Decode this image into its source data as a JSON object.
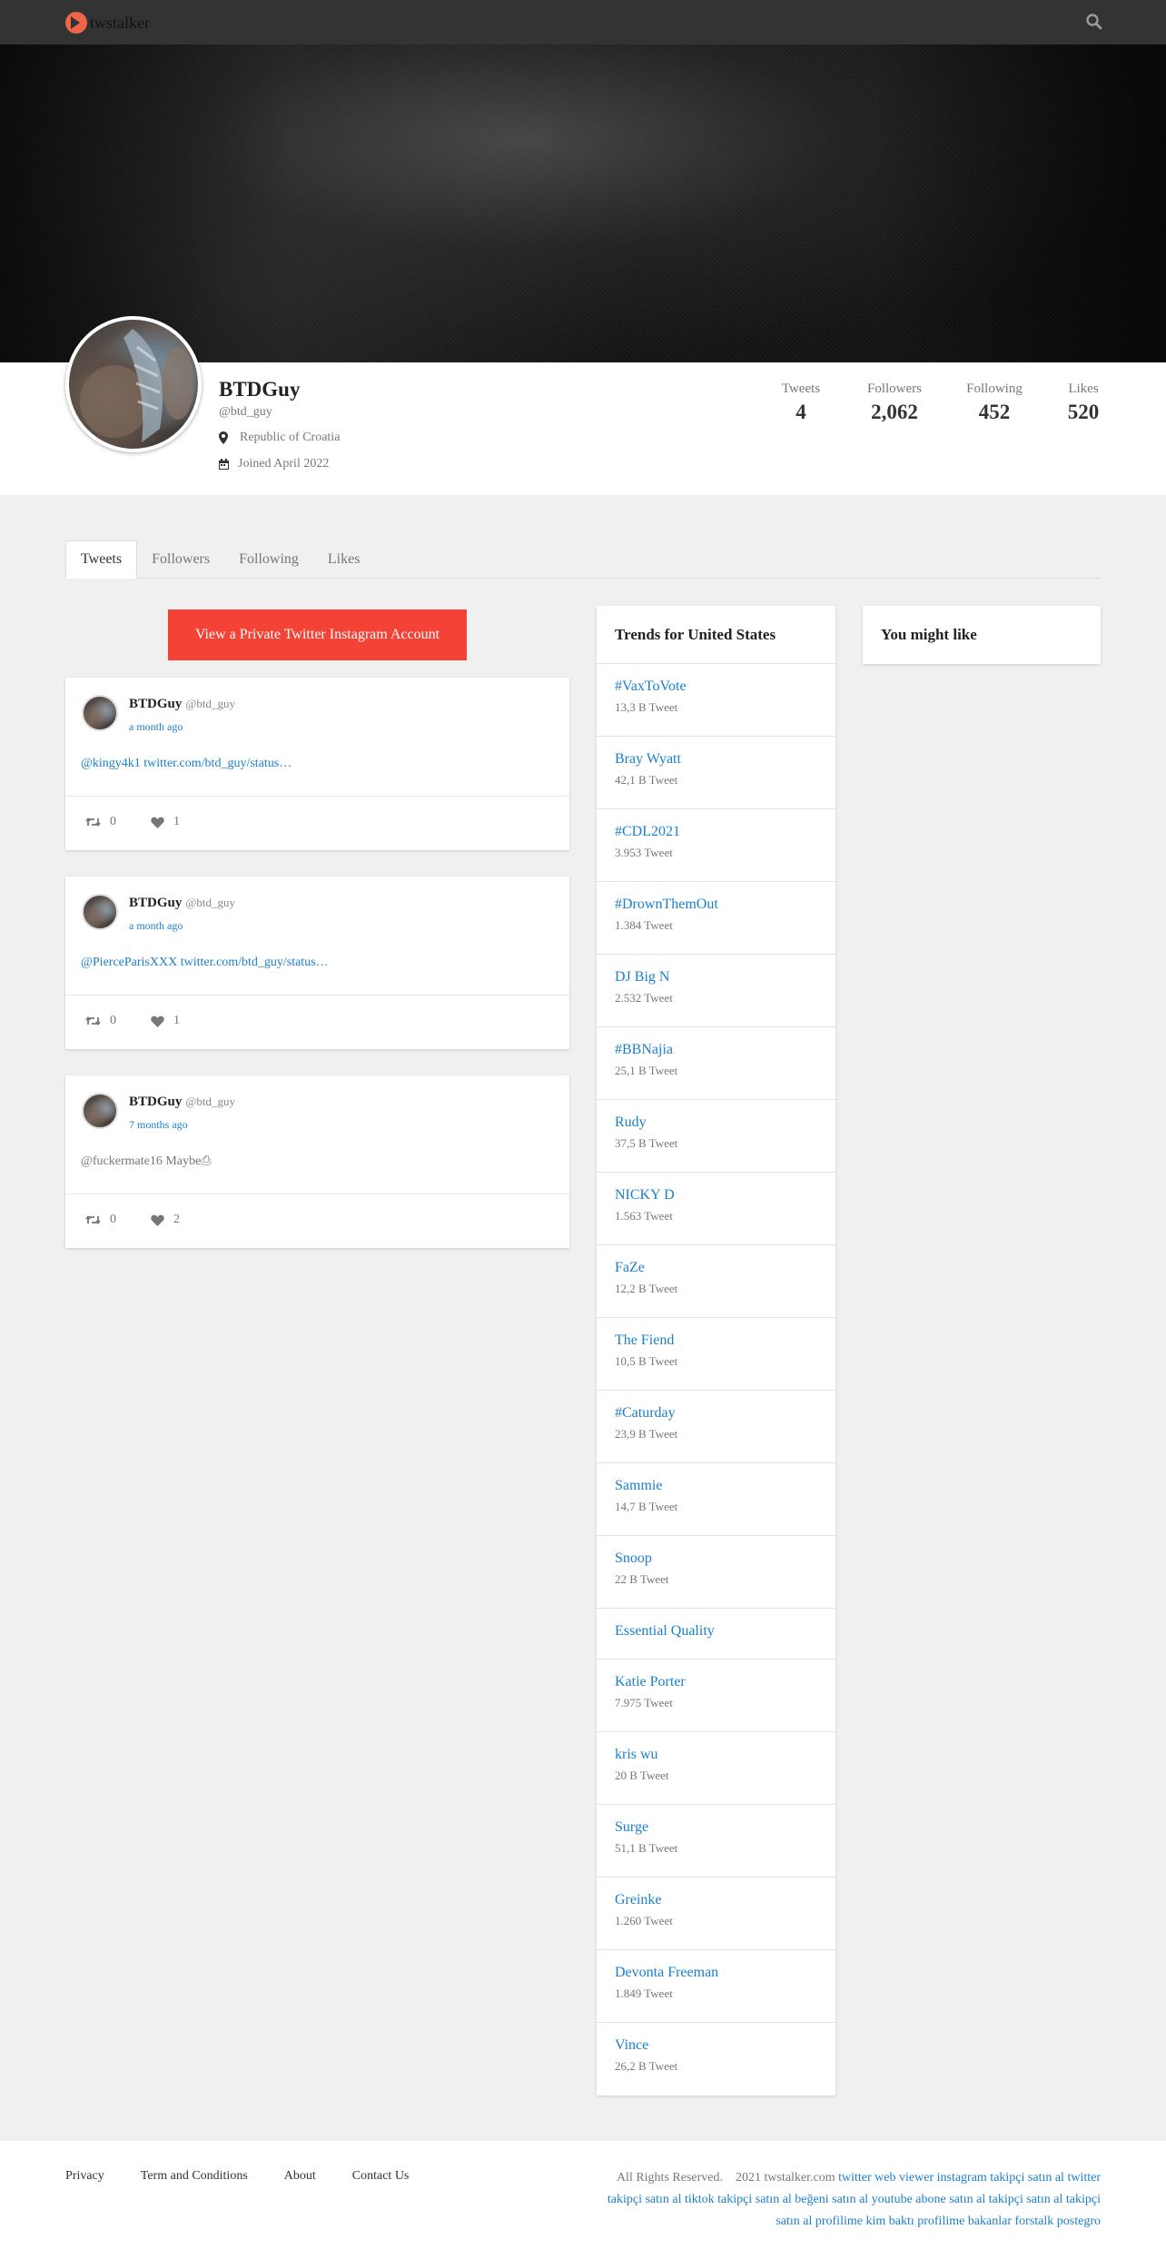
{
  "nav": {
    "brand": "twstalker",
    "brand_color": "#f0654a",
    "search_icon": "search-icon"
  },
  "profile": {
    "name": "BTDGuy",
    "handle": "@btd_guy",
    "location": "Republic of Croatia",
    "joined": "Joined April 2022",
    "stats": [
      {
        "label": "Tweets",
        "value": "4"
      },
      {
        "label": "Followers",
        "value": "2,062"
      },
      {
        "label": "Following",
        "value": "452"
      },
      {
        "label": "Likes",
        "value": "520"
      }
    ]
  },
  "tabs": [
    "Tweets",
    "Followers",
    "Following",
    "Likes"
  ],
  "cta": {
    "label": "View a Private Twitter Instagram Account",
    "color": "#f44336"
  },
  "tweets": [
    {
      "name": "BTDGuy",
      "handle": "@btd_guy",
      "time": "a month ago",
      "text": "@kingy4k1 twitter.com/btd_guy/status…",
      "retweets": "0",
      "likes": "1"
    },
    {
      "name": "BTDGuy",
      "handle": "@btd_guy",
      "time": "a month ago",
      "text": "@PierceParisXXX twitter.com/btd_guy/status…",
      "retweets": "0",
      "likes": "1"
    },
    {
      "name": "BTDGuy",
      "handle": "@btd_guy",
      "time": "7 months ago",
      "text": "@fuckermate16 Maybe⎙",
      "retweets": "0",
      "likes": "2"
    }
  ],
  "trends": {
    "title": "Trends for United States",
    "items": [
      {
        "name": "#VaxToVote",
        "count": "13,3 B Tweet"
      },
      {
        "name": "Bray Wyatt",
        "count": "42,1 B Tweet"
      },
      {
        "name": "#CDL2021",
        "count": "3.953 Tweet"
      },
      {
        "name": "#DrownThemOut",
        "count": "1.384 Tweet"
      },
      {
        "name": "DJ Big N",
        "count": "2.532 Tweet"
      },
      {
        "name": "#BBNajia",
        "count": "25,1 B Tweet"
      },
      {
        "name": "Rudy",
        "count": "37,5 B Tweet"
      },
      {
        "name": "NICKY D",
        "count": "1.563 Tweet"
      },
      {
        "name": "FaZe",
        "count": "12,2 B Tweet"
      },
      {
        "name": "The Fiend",
        "count": "10,5 B Tweet"
      },
      {
        "name": "#Caturday",
        "count": "23,9 B Tweet"
      },
      {
        "name": "Sammie",
        "count": "14,7 B Tweet"
      },
      {
        "name": "Snoop",
        "count": "22 B Tweet"
      },
      {
        "name": "Essential Quality",
        "count": ""
      },
      {
        "name": "Katie Porter",
        "count": "7.975 Tweet"
      },
      {
        "name": "kris wu",
        "count": "20 B Tweet"
      },
      {
        "name": "Surge",
        "count": "51,1 B Tweet"
      },
      {
        "name": "Greinke",
        "count": "1.260 Tweet"
      },
      {
        "name": "Devonta Freeman",
        "count": "1.849 Tweet"
      },
      {
        "name": "Vince",
        "count": "26,2 B Tweet"
      }
    ]
  },
  "you_might_like": {
    "title": "You might like"
  },
  "footer": {
    "links": [
      "Privacy",
      "Term and Conditions",
      "About",
      "Contact Us"
    ],
    "rights": "All Rights Reserved.",
    "copyright": "2021 twstalker.com",
    "promo": "twitter web viewer instagram takipçi satın al twitter takipçi satın al tiktok takipçi satın al beğeni satın al youtube abone satın al takipçi satın al takipçi satın al profilime kim baktı profilime bakanlar forstalk postegro"
  }
}
